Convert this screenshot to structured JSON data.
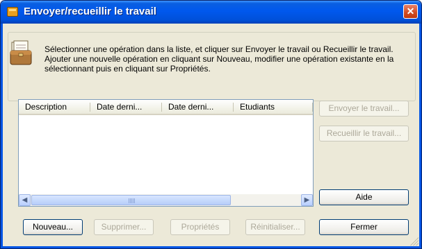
{
  "window": {
    "title": "Envoyer/recueillir le travail",
    "close_glyph": "✕"
  },
  "info": {
    "text": "Sélectionner une opération dans la liste, et cliquer sur Envoyer le travail ou Recueillir le travail. Ajouter une nouvelle opération en cliquant sur Nouveau, modifier une opération existante en la sélectionnant puis en cliquant sur Propriétés."
  },
  "list": {
    "columns": [
      "Description",
      "Date derni...",
      "Date derni...",
      "Etudiants"
    ],
    "rows": []
  },
  "side_buttons": {
    "send": "Envoyer le travail...",
    "collect": "Recueillir le travail...",
    "help": "Aide"
  },
  "bottom_buttons": {
    "new": "Nouveau...",
    "delete": "Supprimer...",
    "properties": "Propriétés",
    "reset": "Réinitialiser...",
    "close": "Fermer"
  },
  "icons": {
    "title": "briefcase-icon",
    "info": "briefcase-icon",
    "close": "close-icon",
    "scroll_left": "arrow-left-icon",
    "scroll_right": "arrow-right-icon"
  },
  "colors": {
    "titlebar": "#0058ee",
    "close_button": "#d04a20",
    "dialog_background": "#ece9d8"
  }
}
